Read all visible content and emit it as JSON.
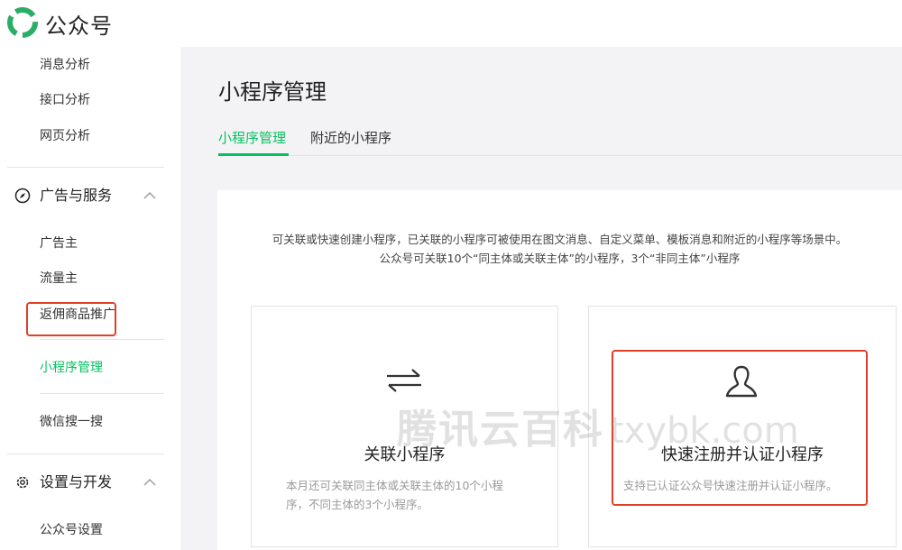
{
  "header": {
    "brand": "公众号"
  },
  "sidebar": {
    "top_items": [
      "消息分析",
      "接口分析",
      "网页分析"
    ],
    "section_ads": {
      "label": "广告与服务",
      "items": [
        "广告主",
        "流量主",
        "返佣商品推广"
      ]
    },
    "active_item": "小程序管理",
    "after_active": "微信搜一搜",
    "section_dev": {
      "label": "设置与开发",
      "items": [
        "公众号设置"
      ]
    }
  },
  "main": {
    "title": "小程序管理",
    "tabs": [
      {
        "label": "小程序管理",
        "active": true
      },
      {
        "label": "附近的小程序",
        "active": false
      }
    ],
    "description": [
      "可关联或快速创建小程序，已关联的小程序可被使用在图文消息、自定义菜单、模板消息和附近的小程序等场景中。",
      "公众号可关联10个“同主体或关联主体”的小程序，3个“非同主体”小程序"
    ],
    "cards": [
      {
        "icon": "swap-arrows-icon",
        "title": "关联小程序",
        "desc_lines": [
          "本月还可关联同主体或关联主体的10个小程",
          "序，不同主体的3个小程序。"
        ]
      },
      {
        "icon": "user-outline-icon",
        "title": "快速注册并认证小程序",
        "desc_lines": [
          "支持已认证公众号快速注册并认证小程序。"
        ]
      }
    ]
  },
  "watermark": {
    "cn": "腾讯云百科",
    "en": "txybk.com"
  },
  "colors": {
    "accent": "#07c160",
    "highlight": "#e0402a"
  }
}
